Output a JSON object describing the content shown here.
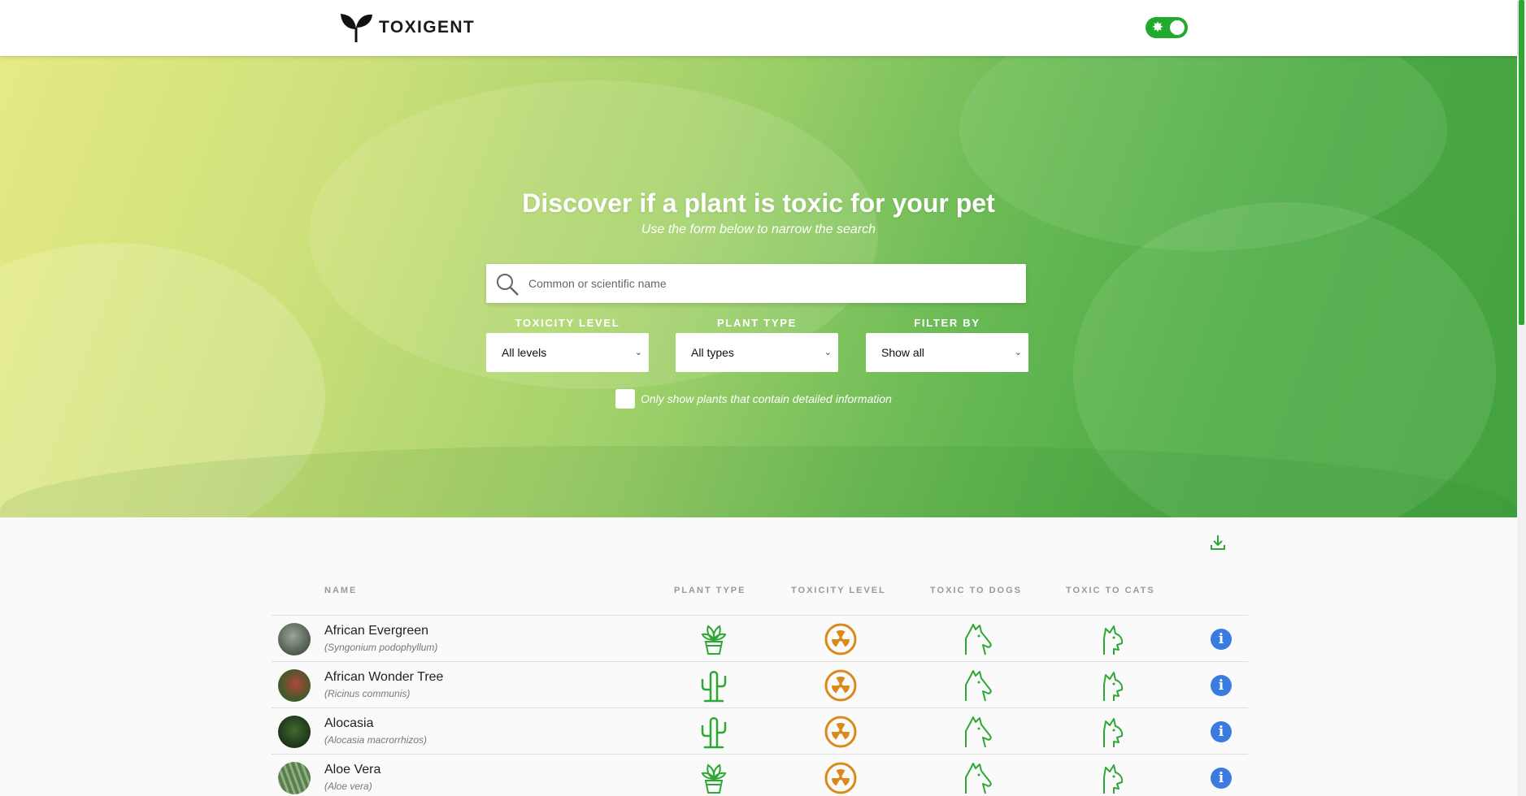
{
  "header": {
    "brand": "TOXIGENT",
    "logo_icon": "sprout-icon",
    "theme_toggle_icon": "sun-icon"
  },
  "hero": {
    "title": "Discover if a plant is toxic for your pet",
    "subtitle": "Use the form below to narrow the search",
    "search": {
      "placeholder": "Common or scientific name",
      "value": ""
    },
    "filters": [
      {
        "label": "TOXICITY LEVEL",
        "selected": "All levels"
      },
      {
        "label": "PLANT TYPE",
        "selected": "All types"
      },
      {
        "label": "FILTER BY",
        "selected": "Show all"
      }
    ],
    "detailed_checkbox": {
      "label": "Only show plants that contain detailed information",
      "checked": false
    }
  },
  "table": {
    "download_icon": "download-icon",
    "columns": [
      "NAME",
      "PLANT TYPE",
      "TOXICITY LEVEL",
      "TOXIC TO DOGS",
      "TOXIC TO CATS"
    ],
    "rows": [
      {
        "name": "African Evergreen",
        "scientific": "(Syngonium podophyllum)",
        "plant_type": "potted-plant-icon",
        "toxicity": "radioactive-icon",
        "dogs": "dog-icon",
        "cats": "cat-icon"
      },
      {
        "name": "African Wonder Tree",
        "scientific": "(Ricinus communis)",
        "plant_type": "cactus-icon",
        "toxicity": "radioactive-icon",
        "dogs": "dog-icon",
        "cats": "cat-icon"
      },
      {
        "name": "Alocasia",
        "scientific": "(Alocasia macrorrhizos)",
        "plant_type": "cactus-icon",
        "toxicity": "radioactive-icon",
        "dogs": "dog-icon",
        "cats": "cat-icon"
      },
      {
        "name": "Aloe Vera",
        "scientific": "(Aloe vera)",
        "plant_type": "potted-plant-icon",
        "toxicity": "radioactive-icon",
        "dogs": "dog-icon",
        "cats": "cat-icon"
      }
    ]
  },
  "colors": {
    "accent_green": "#22a930",
    "toxicity_orange": "#d98a1c",
    "info_blue": "#3a7be0"
  }
}
